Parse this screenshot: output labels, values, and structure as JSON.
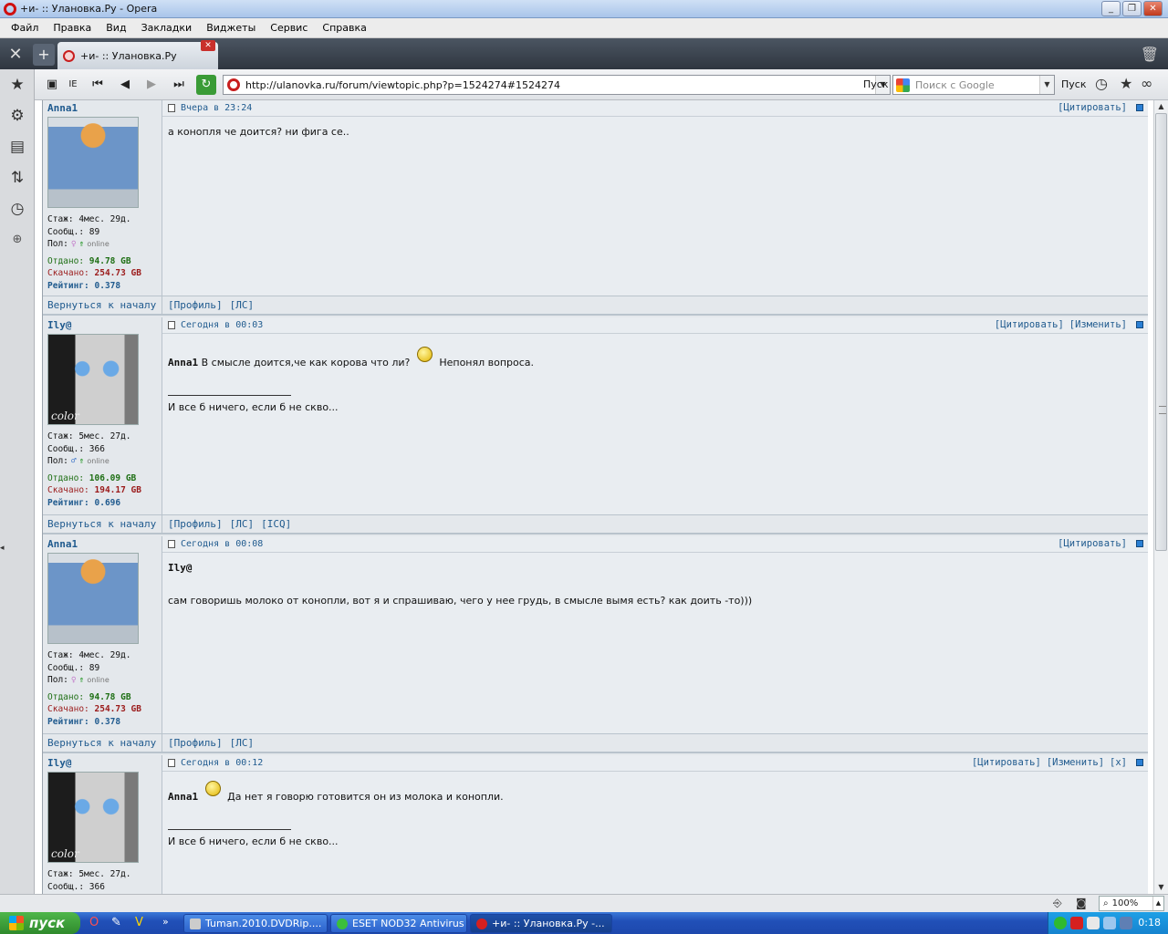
{
  "window": {
    "title": "+и- :: Улановка.Ру - Opera"
  },
  "menu": [
    "Файл",
    "Правка",
    "Вид",
    "Закладки",
    "Виджеты",
    "Сервис",
    "Справка"
  ],
  "tab": {
    "title": "+и- :: Улановка.Ру"
  },
  "toolbar": {
    "ie_label": "IE",
    "url": "http://ulanovka.ru/forum/viewtopic.php?p=1524274#1524274",
    "go_label": "Пуск",
    "search_placeholder": "Поиск с Google",
    "search_go_label": "Пуск"
  },
  "posts": [
    {
      "author": "Anna1",
      "avatar": "cat-avatar",
      "stats": {
        "stazh": "Стаж: 4мес. 29д.",
        "posts": "Сообщ.: 89",
        "gender_label": "Пол:",
        "online": "online"
      },
      "uploaded_label": "Отдано:",
      "uploaded": "94.78 GB",
      "downloaded_label": "Скачано:",
      "downloaded": "254.73 GB",
      "rating_label": "Рейтинг:",
      "rating": "0.378",
      "date": "Вчера в 23:24",
      "actions": [
        "[Цитировать]"
      ],
      "text": "а конопля че доится? ни фига се..",
      "back_label": "Вернуться к началу",
      "links": [
        "[Профиль]",
        "[ЛС]"
      ]
    },
    {
      "author": "Ily@",
      "avatar": "sunglasses-avatar",
      "avatar_sig": "color",
      "stats": {
        "stazh": "Стаж: 5мес. 27д.",
        "posts": "Сообщ.: 366",
        "gender_label": "Пол:",
        "online": "online"
      },
      "uploaded_label": "Отдано:",
      "uploaded": "106.09 GB",
      "downloaded_label": "Скачано:",
      "downloaded": "194.17 GB",
      "rating_label": "Рейтинг:",
      "rating": "0.696",
      "date": "Сегодня в 00:03",
      "actions": [
        "[Цитировать]",
        "[Изменить]"
      ],
      "quote_nick": "Anna1",
      "text_a": "В смысле доится,че как корова что ли?",
      "text_b": "Непонял вопроса.",
      "signature": "И все б ничего, если б не скво...",
      "back_label": "Вернуться к началу",
      "links": [
        "[Профиль]",
        "[ЛС]",
        "[ICQ]"
      ]
    },
    {
      "author": "Anna1",
      "avatar": "cat-avatar",
      "stats": {
        "stazh": "Стаж: 4мес. 29д.",
        "posts": "Сообщ.: 89",
        "gender_label": "Пол:",
        "online": "online"
      },
      "uploaded_label": "Отдано:",
      "uploaded": "94.78 GB",
      "downloaded_label": "Скачано:",
      "downloaded": "254.73 GB",
      "rating_label": "Рейтинг:",
      "rating": "0.378",
      "date": "Сегодня в 00:08",
      "actions": [
        "[Цитировать]"
      ],
      "quote_nick": "Ily@",
      "text": "сам говоришь молоко от конопли, вот я и спрашиваю, чего у нее грудь, в смысле вымя есть? как доить -то)))",
      "back_label": "Вернуться к началу",
      "links": [
        "[Профиль]",
        "[ЛС]"
      ]
    },
    {
      "author": "Ily@",
      "avatar": "sunglasses-avatar",
      "avatar_sig": "color",
      "stats": {
        "stazh": "Стаж: 5мес. 27д.",
        "posts": "Сообщ.: 366"
      },
      "date": "Сегодня в 00:12",
      "actions": [
        "[Цитировать]",
        "[Изменить]",
        "[x]"
      ],
      "quote_nick": "Anna1",
      "text_b": "Да нет я говорю готовится он из молока и конопли.",
      "signature": "И все б ничего, если б не скво..."
    }
  ],
  "status": {
    "zoom": "100%"
  },
  "taskbar": {
    "start_label": "пуск",
    "tasks": [
      "Tuman.2010.DVDRip....",
      "ESET NOD32 Antivirus",
      "+и- :: Улановка.Ру -..."
    ],
    "clock": "0:18"
  }
}
